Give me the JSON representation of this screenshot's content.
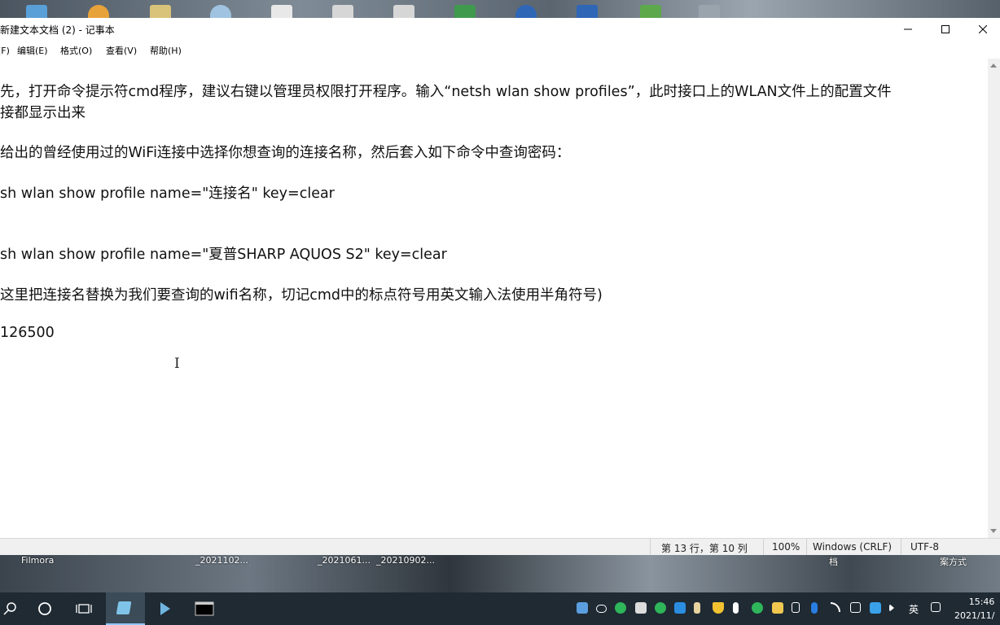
{
  "window": {
    "title": "新建文本文档 (2) - 记事本"
  },
  "menu": [
    {
      "label": "件(F)"
    },
    {
      "label": "编辑(E)"
    },
    {
      "label": "格式(O)"
    },
    {
      "label": "查看(V)"
    },
    {
      "label": "帮助(H)"
    }
  ],
  "document": {
    "lines": [
      "先，打开命令提示符cmd程序，建议右键以管理员权限打开程序。输入“netsh wlan show profiles”，此时接口上的WLAN文件上的配置文件",
      "接都显示出来",
      "给出的曾经使用过的WiFi连接中选择你想查询的连接名称，然后套入如下命令中查询密码：",
      "sh wlan show profile name=\"连接名\" key=clear",
      "sh wlan show profile name=\"夏普SHARP AQUOS S2\" key=clear",
      "这里把连接名替换为我们要查询的wifi名称，切记cmd中的标点符号用英文输入法使用半角符号)",
      "126500"
    ]
  },
  "status": {
    "position": "第 13 行，第 10 列",
    "zoom": "100%",
    "line_ending": "Windows (CRLF)",
    "encoding": "UTF-8"
  },
  "desktop_labels": [
    "Filmora",
    "_2021102...",
    "_2021061...",
    "_20210902...",
    "档",
    "案方式"
  ],
  "taskbar": {
    "ime": "英",
    "time": "15:46",
    "date": "2021/11/"
  },
  "colors": {
    "taskbar_bg": "#1f2a33",
    "accent": "#8fc7ff",
    "window_bg": "#ffffff",
    "statusbar_bg": "#f0f0f0"
  }
}
